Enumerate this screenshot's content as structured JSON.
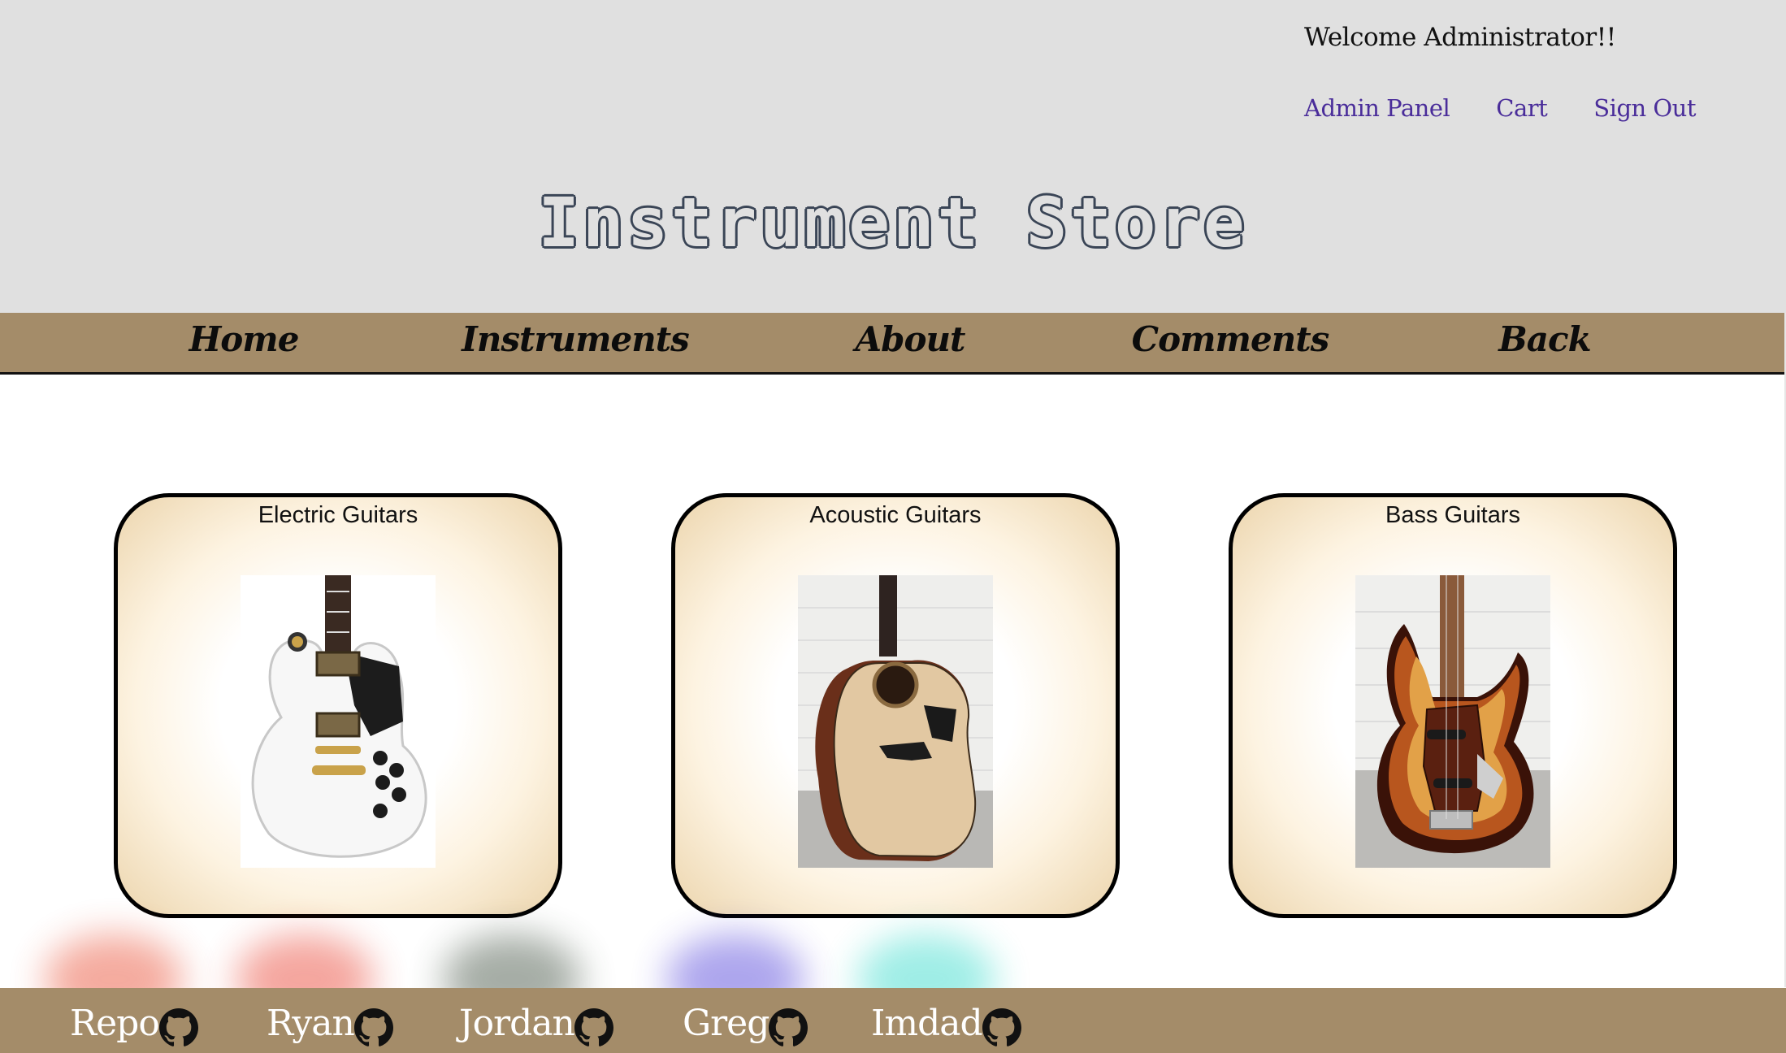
{
  "header": {
    "welcome": "Welcome Administrator!!",
    "links": [
      "Admin Panel",
      "Cart",
      "Sign Out"
    ],
    "title": "Instrument Store"
  },
  "nav": {
    "items": [
      "Home",
      "Instruments",
      "About",
      "Comments",
      "Back"
    ]
  },
  "cards": [
    {
      "title": "Electric Guitars",
      "image": "electric-guitar-image"
    },
    {
      "title": "Acoustic Guitars",
      "image": "acoustic-guitar-image"
    },
    {
      "title": "Bass Guitars",
      "image": "bass-guitar-image"
    }
  ],
  "footer": {
    "links": [
      {
        "label": "Repo",
        "icon": "github-icon",
        "glow": "#e8462a"
      },
      {
        "label": "Ryan",
        "icon": "github-icon",
        "glow": "#e83b2a"
      },
      {
        "label": "Jordan",
        "icon": "github-icon",
        "glow": "#3a4a3a"
      },
      {
        "label": "Greg",
        "icon": "github-icon",
        "glow": "#4a3ad8"
      },
      {
        "label": "Imdad",
        "icon": "github-icon",
        "glow": "#2ad8c8"
      }
    ]
  },
  "colors": {
    "header_bg": "#e0e0e0",
    "bar_bg": "#a48c69",
    "link": "#4a2d9a"
  }
}
